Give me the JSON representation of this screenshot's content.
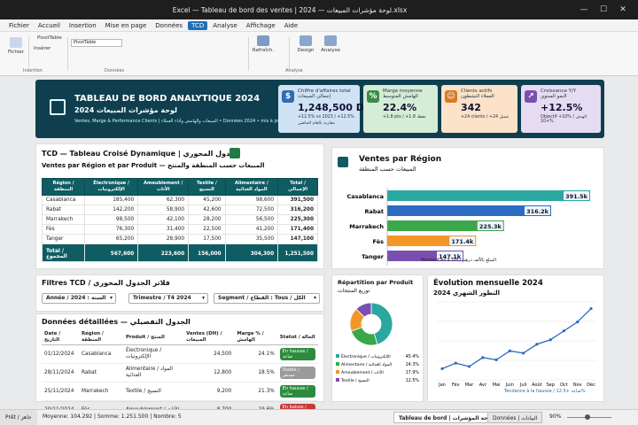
{
  "window": {
    "title": "Excel — Tableau de bord des ventes | لوحة مؤشرات المبيعات — 2024.xlsx"
  },
  "menu": [
    "Fichier",
    "Accueil",
    "Insertion",
    "Mise en page",
    "Données",
    "TCD",
    "Analyse",
    "Affichage",
    "Aide"
  ],
  "menu_active_index": 5,
  "ribbon": {
    "fichier": "Fichier",
    "pivot_label": "PivotTable",
    "pivot_sub": "Insérer",
    "group_insertion": "Insertion",
    "field_value": "PivotTable",
    "group_donnees": "Données",
    "refresh": "Rafraîch.",
    "design": "Design",
    "analyse": "Analyse",
    "group_analyse": "Analyse"
  },
  "header": {
    "title": "TABLEAU DE BORD ANALYTIQUE 2024",
    "title_ar": "لوحة مؤشرات المبيعات 2024",
    "subtitle": "Ventes, Marge & Performance Clients | المبيعات والهامش وأداء العملاء • Données 2024 • mis à jour 30/11/2024"
  },
  "kpis": [
    {
      "icon": "$",
      "title": "Chiffre d'affaires total",
      "title_ar": "إجمالي المبيعات",
      "value": "1,248,500 DH",
      "note": "+12.5% vs 2023 / +12.5%",
      "note2": "مقارنة بالعام الماضي",
      "color": "#cfe3f5",
      "icon_color": "#2f6db5"
    },
    {
      "icon": "%",
      "title": "Marge moyenne",
      "title_ar": "الهامش المتوسط",
      "value": "22.4%",
      "note": "+1.8 pts / +1.8 نقطة",
      "note2": "",
      "color": "#d5ecd6",
      "icon_color": "#3a8c48"
    },
    {
      "icon": "☺",
      "title": "Clients actifs",
      "title_ar": "العملاء النشطون",
      "value": "342",
      "note": "+24 clients / +24 عميل",
      "note2": "",
      "color": "#fbe2c9",
      "icon_color": "#d97a1e"
    },
    {
      "icon": "↗",
      "title": "Croissance Y/Y",
      "title_ar": "النمو السنوي",
      "value": "+12.5%",
      "note": "Objectif +10% / الهدف +10%",
      "note2": "",
      "color": "#e6dcf2",
      "icon_color": "#7a4fb0"
    }
  ],
  "pivot": {
    "title": "TCD — Tableau Croisé Dynamique | الجدول المحوري",
    "subtitle": "Ventes par Région et par Produit — المبيعات حسب المنطقة والمنتج",
    "headers": [
      "Région / المنطقة",
      "Électronique / الإلكترونيات",
      "Ameublement / الأثاث",
      "Textile / النسيج",
      "Alimentaire / المواد الغذائية",
      "Total / الإجمالي"
    ],
    "rows": [
      [
        "Casablanca",
        "185,400",
        "62,300",
        "45,200",
        "98,600",
        "391,500"
      ],
      [
        "Rabat",
        "142,200",
        "58,900",
        "42,600",
        "72,500",
        "316,200"
      ],
      [
        "Marrakech",
        "98,500",
        "42,100",
        "28,200",
        "56,500",
        "225,300"
      ],
      [
        "Fès",
        "76,300",
        "31,400",
        "22,500",
        "41,200",
        "171,400"
      ],
      [
        "Tanger",
        "65,200",
        "28,900",
        "17,500",
        "35,500",
        "147,100"
      ]
    ],
    "total": [
      "Total / المجموع",
      "567,600",
      "223,600",
      "156,000",
      "304,300",
      "1,251,500"
    ]
  },
  "filters": {
    "title": "Filtres TCD / فلاتر الجدول المحوري",
    "year": "Année / السنة : 2024",
    "quarter": "Trimestre / T4 2024",
    "segment": "Segment / القطاع : Tous / الكل"
  },
  "details": {
    "title": "Données détaillées — الجدول التفصيلي",
    "headers": [
      "Date / التاريخ",
      "Région / المنطقة",
      "Produit / المنتج",
      "Ventes (DH) / المبيعات",
      "Marge % / الهامش",
      "Statut / الحالة"
    ],
    "rows": [
      {
        "date": "01/12/2024",
        "region": "Casablanca",
        "product": "Électronique / الإلكترونيات",
        "sales": "24,500",
        "margin": "24.1%",
        "status": "En hausse / صاعد",
        "status_color": "#2e8b3e"
      },
      {
        "date": "28/11/2024",
        "region": "Rabat",
        "product": "Alimentaire / المواد الغذائية",
        "sales": "12,800",
        "margin": "18.5%",
        "status": "Stable / مستقر",
        "status_color": "#9a9a9a"
      },
      {
        "date": "25/11/2024",
        "region": "Marrakech",
        "product": "Textile / النسيج",
        "sales": "9,200",
        "margin": "21.3%",
        "status": "En hausse / صاعد",
        "status_color": "#2e8b3e"
      },
      {
        "date": "20/11/2024",
        "region": "Fès",
        "product": "Ameublement / الأثاث",
        "sales": "8,700",
        "margin": "19.6%",
        "status": "En baisse / نازل",
        "status_color": "#c73a3a"
      }
    ]
  },
  "bar_panel": {
    "title": "Ventes par Région",
    "title_ar": "المبيعات حسب المنطقة",
    "xlabel": "Montant en k DH / المبلغ بالألف درهم"
  },
  "pie_panel": {
    "title": "Répartition par Produit",
    "title_ar": "توزيع المنتجات"
  },
  "line_panel": {
    "title": "Évolution mensuelle 2024",
    "title_ar": "التطور الشهري 2024",
    "note": "Tendance à la hausse / صاعد +12.5%"
  },
  "chart_data": [
    {
      "type": "bar",
      "orientation": "horizontal",
      "title": "Ventes par Région",
      "categories": [
        "Casablanca",
        "Rabat",
        "Marrakech",
        "Fès",
        "Tanger"
      ],
      "values": [
        391.5,
        316.2,
        225.3,
        171.4,
        147.1
      ],
      "labels": [
        "391.5k",
        "316.2k",
        "225.3k",
        "171.4k",
        "147.1k"
      ],
      "colors": [
        "#2aa8a0",
        "#2b6cc2",
        "#3aa84a",
        "#f2962a",
        "#7a4fb0"
      ],
      "xlabel": "Montant en k DH / المبلغ بالألف درهم",
      "xlim": [
        0,
        400
      ]
    },
    {
      "type": "pie",
      "title": "Répartition par Produit",
      "donut": true,
      "categories": [
        "Électronique / الإلكترونيات",
        "Alimentaire / المواد الغذائية",
        "Ameublement / الأثاث",
        "Textile / النسيج"
      ],
      "values": [
        45.4,
        24.3,
        17.9,
        12.5
      ],
      "labels": [
        "45.4%",
        "24.3%",
        "17.9%",
        "12.5%"
      ],
      "colors": [
        "#2aa8a0",
        "#3aa84a",
        "#f2962a",
        "#7a4fb0"
      ]
    },
    {
      "type": "line",
      "title": "Évolution mensuelle 2024",
      "x": [
        "Jan",
        "Fév",
        "Mar",
        "Avr",
        "Mai",
        "Juin",
        "Juil",
        "Août",
        "Sep",
        "Oct",
        "Nov",
        "Déc"
      ],
      "x_tick_labels": [
        "Jan",
        "Fév",
        "Mar",
        "Avr",
        "Mai",
        "Juin",
        "Juil",
        "Août",
        "Sep",
        "Oct",
        "Nov",
        "Déc"
      ],
      "y": [
        70,
        75,
        72,
        80,
        78,
        86,
        84,
        92,
        96,
        104,
        112,
        124
      ],
      "ylim": [
        60,
        130
      ],
      "grid": true,
      "color": "#2b6cc2"
    }
  ],
  "statusbar": {
    "ready": "Prêt / جاهز",
    "stats": "Moyenne: 104.292 | Somme: 1.251.500 | Nombre: 5",
    "sheet1": "Tableau de bord | لوحة المؤشرات",
    "sheet2": "Données | البيانات",
    "zoom": "90%"
  }
}
